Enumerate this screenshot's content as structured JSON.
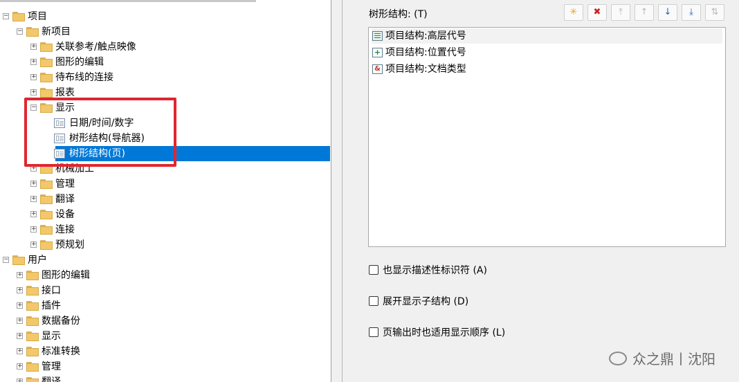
{
  "tree": {
    "items": [
      {
        "label": "项目",
        "level": 0,
        "expanded": true,
        "icon": "folder-icon"
      },
      {
        "label": "新项目",
        "level": 1,
        "expanded": true,
        "icon": "folder-icon"
      },
      {
        "label": "关联参考/触点映像",
        "level": 2,
        "expanded": false,
        "icon": "folder-icon"
      },
      {
        "label": "图形的编辑",
        "level": 2,
        "expanded": false,
        "icon": "folder-icon"
      },
      {
        "label": "待布线的连接",
        "level": 2,
        "expanded": false,
        "icon": "folder-icon"
      },
      {
        "label": "报表",
        "level": 2,
        "expanded": false,
        "icon": "folder-icon"
      },
      {
        "label": "显示",
        "level": 2,
        "expanded": true,
        "icon": "folder-icon"
      },
      {
        "label": "日期/时间/数字",
        "level": 3,
        "icon": "settings-page-icon"
      },
      {
        "label": "树形结构(导航器)",
        "level": 3,
        "icon": "settings-page-icon"
      },
      {
        "label": "树形结构(页)",
        "level": 3,
        "icon": "settings-page-icon",
        "selected": true
      },
      {
        "label": "机械加工",
        "level": 2,
        "expanded": false,
        "icon": "folder-icon"
      },
      {
        "label": "管理",
        "level": 2,
        "expanded": false,
        "icon": "folder-icon"
      },
      {
        "label": "翻译",
        "level": 2,
        "expanded": false,
        "icon": "folder-icon"
      },
      {
        "label": "设备",
        "level": 2,
        "expanded": false,
        "icon": "folder-icon"
      },
      {
        "label": "连接",
        "level": 2,
        "expanded": false,
        "icon": "folder-icon"
      },
      {
        "label": "预规划",
        "level": 2,
        "expanded": false,
        "icon": "folder-icon"
      },
      {
        "label": "用户",
        "level": 0,
        "expanded": true,
        "icon": "folder-icon"
      },
      {
        "label": "图形的编辑",
        "level": 1,
        "expanded": false,
        "icon": "folder-icon"
      },
      {
        "label": "接口",
        "level": 1,
        "expanded": false,
        "icon": "folder-icon"
      },
      {
        "label": "插件",
        "level": 1,
        "expanded": false,
        "icon": "folder-icon"
      },
      {
        "label": "数据备份",
        "level": 1,
        "expanded": false,
        "icon": "folder-icon"
      },
      {
        "label": "显示",
        "level": 1,
        "expanded": false,
        "icon": "folder-icon"
      },
      {
        "label": "标准转换",
        "level": 1,
        "expanded": false,
        "icon": "folder-icon"
      },
      {
        "label": "管理",
        "level": 1,
        "expanded": false,
        "icon": "folder-icon"
      },
      {
        "label": "翻译",
        "level": 1,
        "expanded": false,
        "icon": "folder-icon"
      }
    ]
  },
  "panel": {
    "title": "树形结构: (T)",
    "toolbar": [
      {
        "icon": "new-icon",
        "glyph": "✳",
        "color": "#e8a020",
        "enabled": true
      },
      {
        "icon": "delete-icon",
        "glyph": "✖",
        "color": "#d02020",
        "enabled": true
      },
      {
        "icon": "move-top-icon",
        "glyph": "⤒",
        "color": "#b8b8b8",
        "enabled": false
      },
      {
        "icon": "move-up-icon",
        "glyph": "↑",
        "color": "#b8b8b8",
        "enabled": false
      },
      {
        "icon": "move-down-icon",
        "glyph": "↓",
        "color": "#1a5fb4",
        "enabled": true
      },
      {
        "icon": "move-bottom-icon",
        "glyph": "⤓",
        "color": "#1a5fb4",
        "enabled": true
      },
      {
        "icon": "sort-icon",
        "glyph": "⇅",
        "color": "#b8b8b8",
        "enabled": false
      }
    ],
    "list": [
      {
        "label": "项目结构:高层代号",
        "icon": "hierarchy-icon"
      },
      {
        "label": "项目结构:位置代号",
        "icon": "location-icon"
      },
      {
        "label": "项目结构:文档类型",
        "icon": "document-type-icon"
      }
    ],
    "checkboxes": [
      {
        "label": "也显示描述性标识符 (A)",
        "checked": false
      },
      {
        "label": "展开显示子结构 (D)",
        "checked": false
      },
      {
        "label": "页输出时也适用显示顺序 (L)",
        "checked": false
      }
    ]
  },
  "watermark": {
    "text": "众之鼎丨沈阳"
  }
}
